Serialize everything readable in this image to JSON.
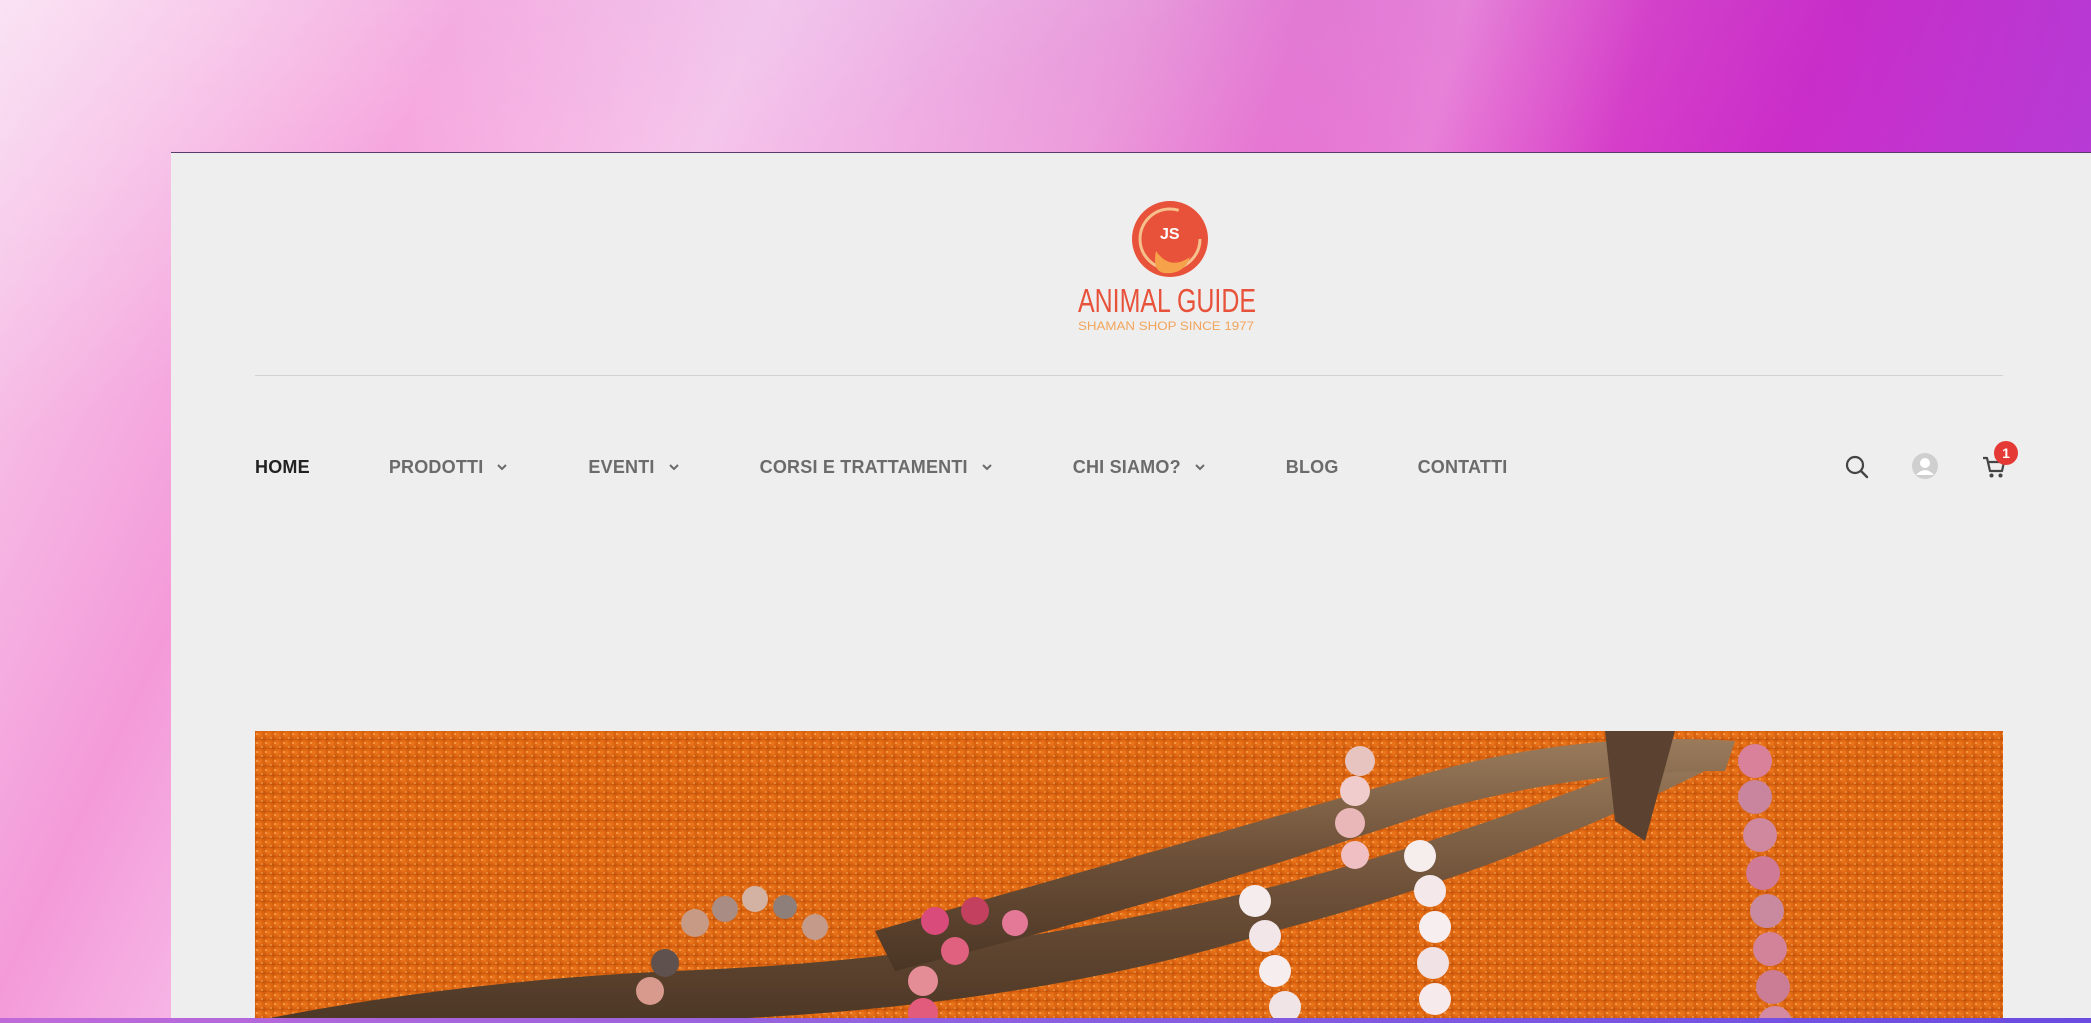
{
  "site": {
    "logo_text": "ANIMAL GUIDE",
    "logo_tagline": "SHAMAN SHOP SINCE 1977",
    "logo_monogram": "JS"
  },
  "nav": {
    "items": [
      {
        "label": "HOME",
        "active": true,
        "dropdown": false
      },
      {
        "label": "PRODOTTI",
        "active": false,
        "dropdown": true
      },
      {
        "label": "EVENTI",
        "active": false,
        "dropdown": true
      },
      {
        "label": "CORSI E TRATTAMENTI",
        "active": false,
        "dropdown": true
      },
      {
        "label": "CHI SIAMO?",
        "active": false,
        "dropdown": true
      },
      {
        "label": "BLOG",
        "active": false,
        "dropdown": false
      },
      {
        "label": "CONTATTI",
        "active": false,
        "dropdown": false
      }
    ]
  },
  "header_icons": {
    "search": "search-icon",
    "account": "user-icon",
    "cart": "cart-icon",
    "cart_count": "1"
  },
  "colors": {
    "brand": "#e8523a",
    "brand_light": "#f2a45a",
    "badge": "#e53935",
    "page_bg": "#eeeeee"
  }
}
